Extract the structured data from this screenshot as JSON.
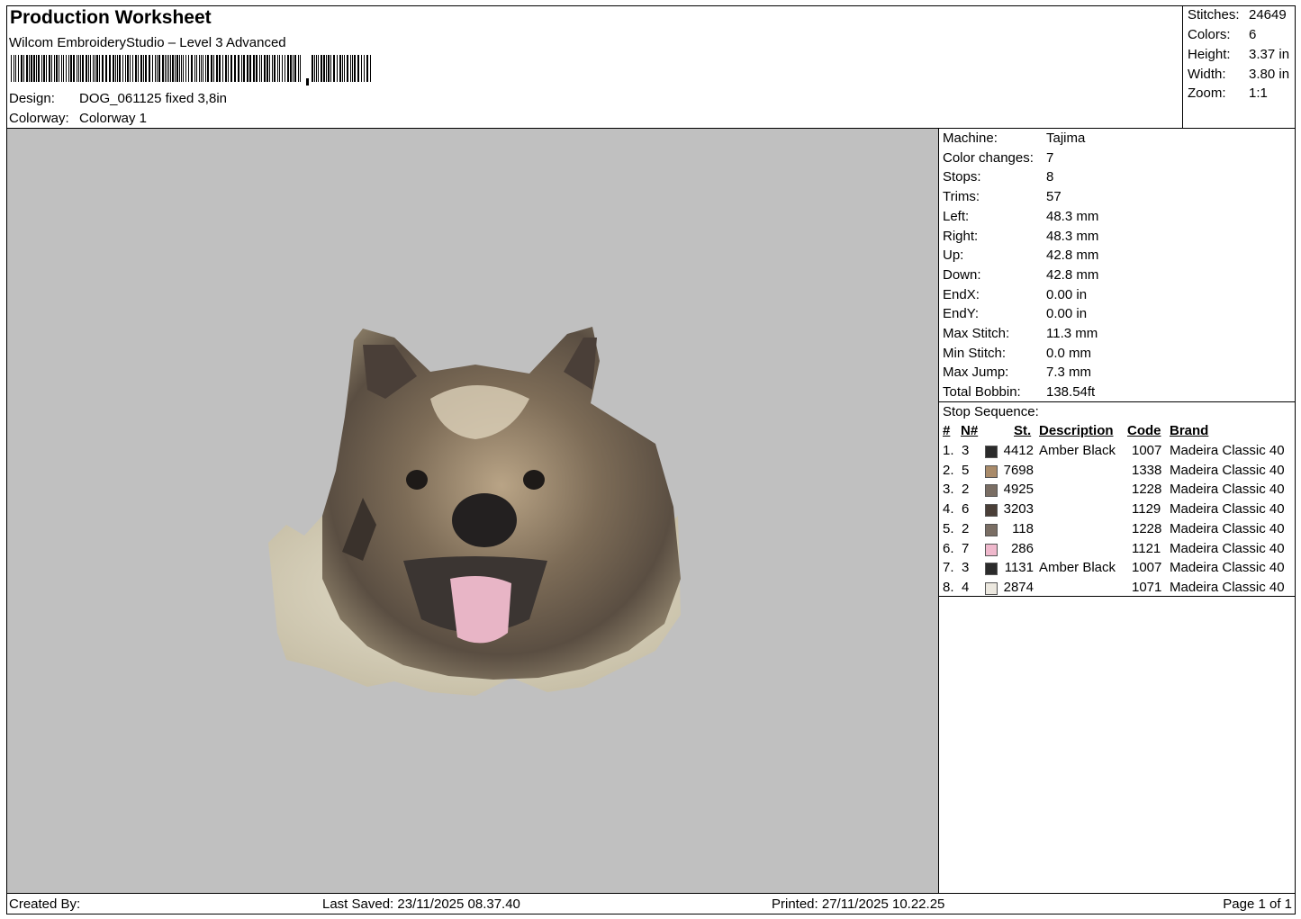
{
  "header": {
    "title": "Production Worksheet",
    "software": "Wilcom EmbroideryStudio – Level 3 Advanced",
    "design_label": "Design:",
    "design_value": "DOG_061125 fixed 3,8in",
    "colorway_label": "Colorway:",
    "colorway_value": "Colorway 1"
  },
  "stats": {
    "stitches_label": "Stitches:",
    "stitches": "24649",
    "colors_label": "Colors:",
    "colors": "6",
    "height_label": "Height:",
    "height": "3.37 in",
    "width_label": "Width:",
    "width": "3.80 in",
    "zoom_label": "Zoom:",
    "zoom": "1:1"
  },
  "machine": [
    {
      "label": "Machine:",
      "value": "Tajima"
    },
    {
      "label": "Color changes:",
      "value": "7"
    },
    {
      "label": "Stops:",
      "value": "8"
    },
    {
      "label": "Trims:",
      "value": "57"
    },
    {
      "label": "Left:",
      "value": "48.3 mm"
    },
    {
      "label": "Right:",
      "value": "48.3 mm"
    },
    {
      "label": "Up:",
      "value": "42.8 mm"
    },
    {
      "label": "Down:",
      "value": "42.8 mm"
    },
    {
      "label": "EndX:",
      "value": "0.00 in"
    },
    {
      "label": "EndY:",
      "value": "0.00 in"
    },
    {
      "label": "Max Stitch:",
      "value": "11.3 mm"
    },
    {
      "label": "Min Stitch:",
      "value": "0.0 mm"
    },
    {
      "label": "Max Jump:",
      "value": "7.3 mm"
    },
    {
      "label": "Total Bobbin:",
      "value": "138.54ft"
    }
  ],
  "stop_sequence": {
    "title": "Stop Sequence:",
    "headers": {
      "num": "#",
      "n": "N#",
      "st": "St.",
      "desc": "Description",
      "code": "Code",
      "brand": "Brand"
    },
    "rows": [
      {
        "num": "1.",
        "n": "3",
        "color": "#2b2b2b",
        "st": "4412",
        "desc": "Amber Black",
        "code": "1007",
        "brand": "Madeira Classic 40"
      },
      {
        "num": "2.",
        "n": "5",
        "color": "#a98b6a",
        "st": "7698",
        "desc": "",
        "code": "1338",
        "brand": "Madeira Classic 40"
      },
      {
        "num": "3.",
        "n": "2",
        "color": "#7a6e64",
        "st": "4925",
        "desc": "",
        "code": "1228",
        "brand": "Madeira Classic 40"
      },
      {
        "num": "4.",
        "n": "6",
        "color": "#4a3f38",
        "st": "3203",
        "desc": "",
        "code": "1129",
        "brand": "Madeira Classic 40"
      },
      {
        "num": "5.",
        "n": "2",
        "color": "#7a6e64",
        "st": "118",
        "desc": "",
        "code": "1228",
        "brand": "Madeira Classic 40"
      },
      {
        "num": "6.",
        "n": "7",
        "color": "#efb8cc",
        "st": "286",
        "desc": "",
        "code": "1121",
        "brand": "Madeira Classic 40"
      },
      {
        "num": "7.",
        "n": "3",
        "color": "#2b2b2b",
        "st": "1131",
        "desc": "Amber Black",
        "code": "1007",
        "brand": "Madeira Classic 40"
      },
      {
        "num": "8.",
        "n": "4",
        "color": "#ece8df",
        "st": "2874",
        "desc": "",
        "code": "1071",
        "brand": "Madeira Classic 40"
      }
    ]
  },
  "footer": {
    "created_by": "Created By:",
    "last_saved": "Last Saved: 23/11/2025 08.37.40",
    "printed": "Printed: 27/11/2025 10.22.25",
    "page": "Page 1 of 1"
  }
}
